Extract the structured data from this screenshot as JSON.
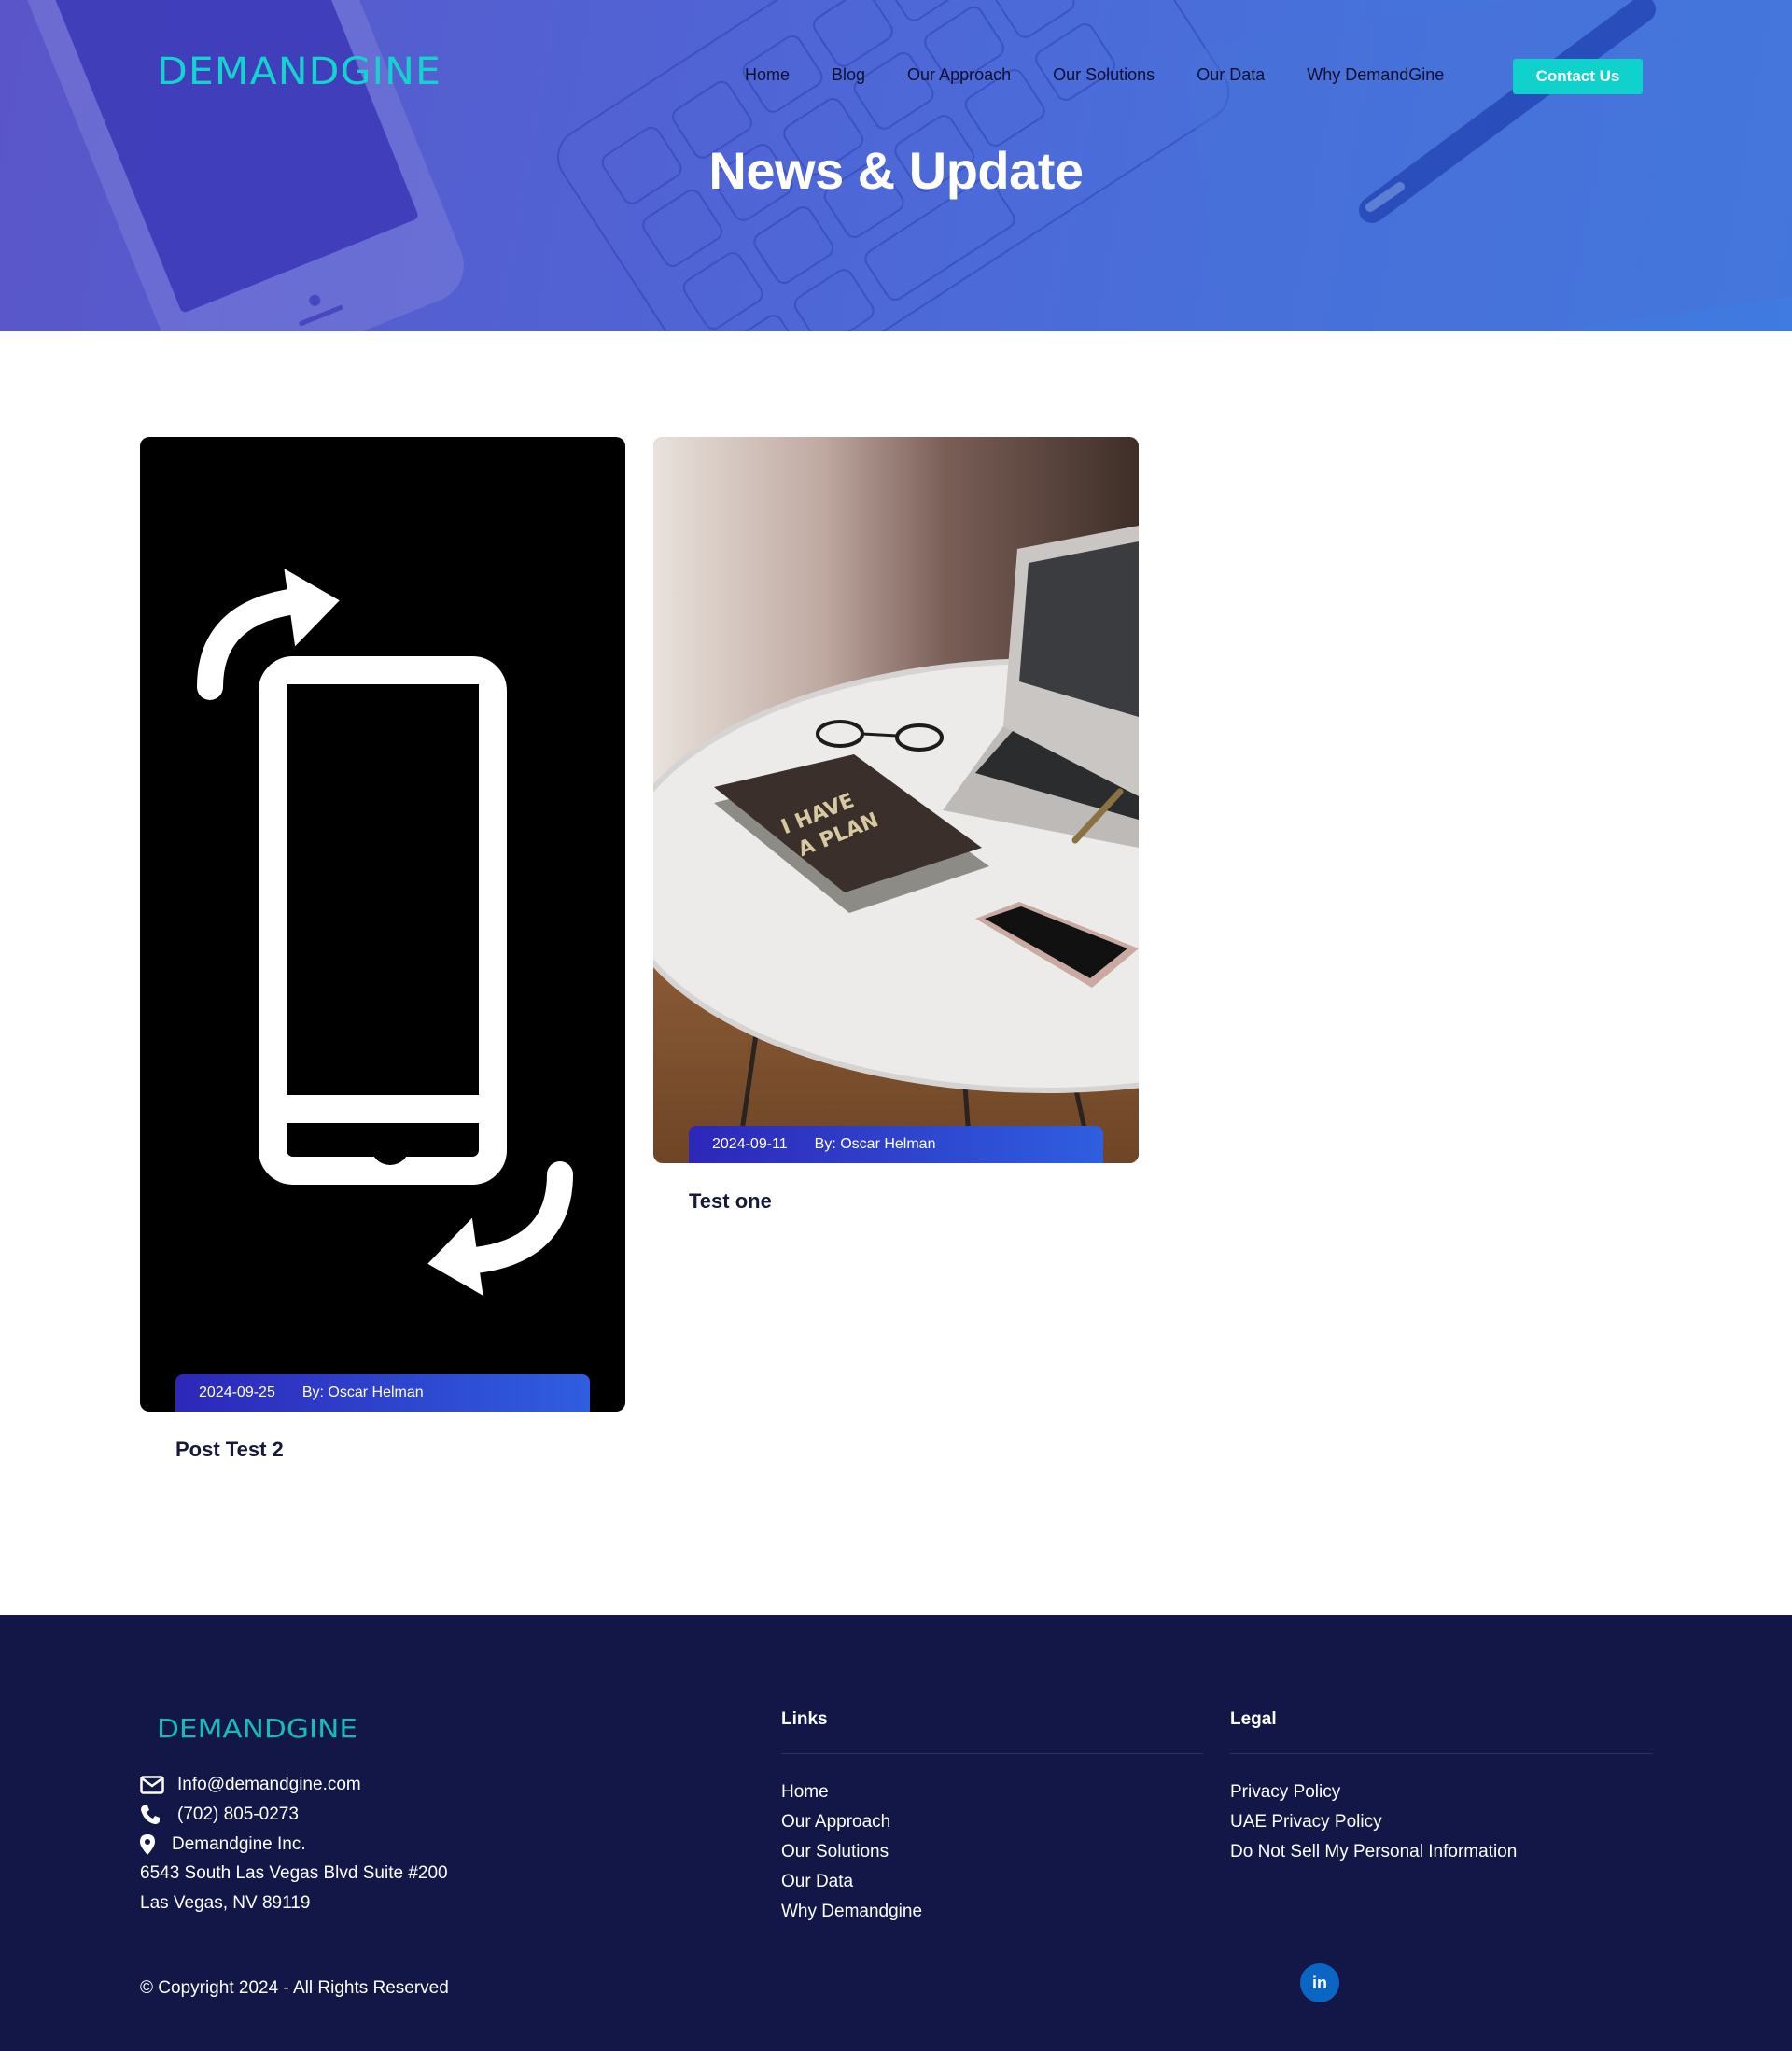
{
  "header": {
    "logo_text": "DEMANDGINE",
    "nav": [
      "Home",
      "Blog",
      "Our Approach",
      "Our Solutions",
      "Our Data",
      "Why DemandGine"
    ],
    "contact_label": "Contact Us",
    "title": "News & Update"
  },
  "posts": [
    {
      "date": "2024-09-25",
      "author": "By: Oscar Helman",
      "title": "Post Test 2",
      "image": "phone-rotate-icon"
    },
    {
      "date": "2024-09-11",
      "author": "By: Oscar Helman",
      "title": "Test one",
      "image": "desk-laptop-photo"
    }
  ],
  "footer": {
    "logo_text": "DEMANDGINE",
    "email": "Info@demandgine.com",
    "phone": "(702) 805-0273",
    "company": "Demandgine Inc.",
    "address_1": "6543 South Las Vegas Blvd Suite #200",
    "address_2": "Las Vegas, NV 89119",
    "links_title": "Links",
    "links": [
      "Home",
      "Our Approach",
      "Our Solutions",
      "Our Data",
      "Why Demandgine"
    ],
    "legal_title": "Legal",
    "legal": [
      "Privacy Policy",
      "UAE Privacy Policy",
      "Do Not Sell My Personal Information"
    ],
    "copyright": "© Copyright 2024 - All Rights Reserved",
    "social": "in"
  },
  "colors": {
    "accent": "#10d2cc",
    "footer_bg": "#131748",
    "hero_gradient": [
      "#5a56c9",
      "#3f7be0"
    ],
    "meta_gradient": [
      "#2d27b8",
      "#2f5ee0"
    ]
  }
}
